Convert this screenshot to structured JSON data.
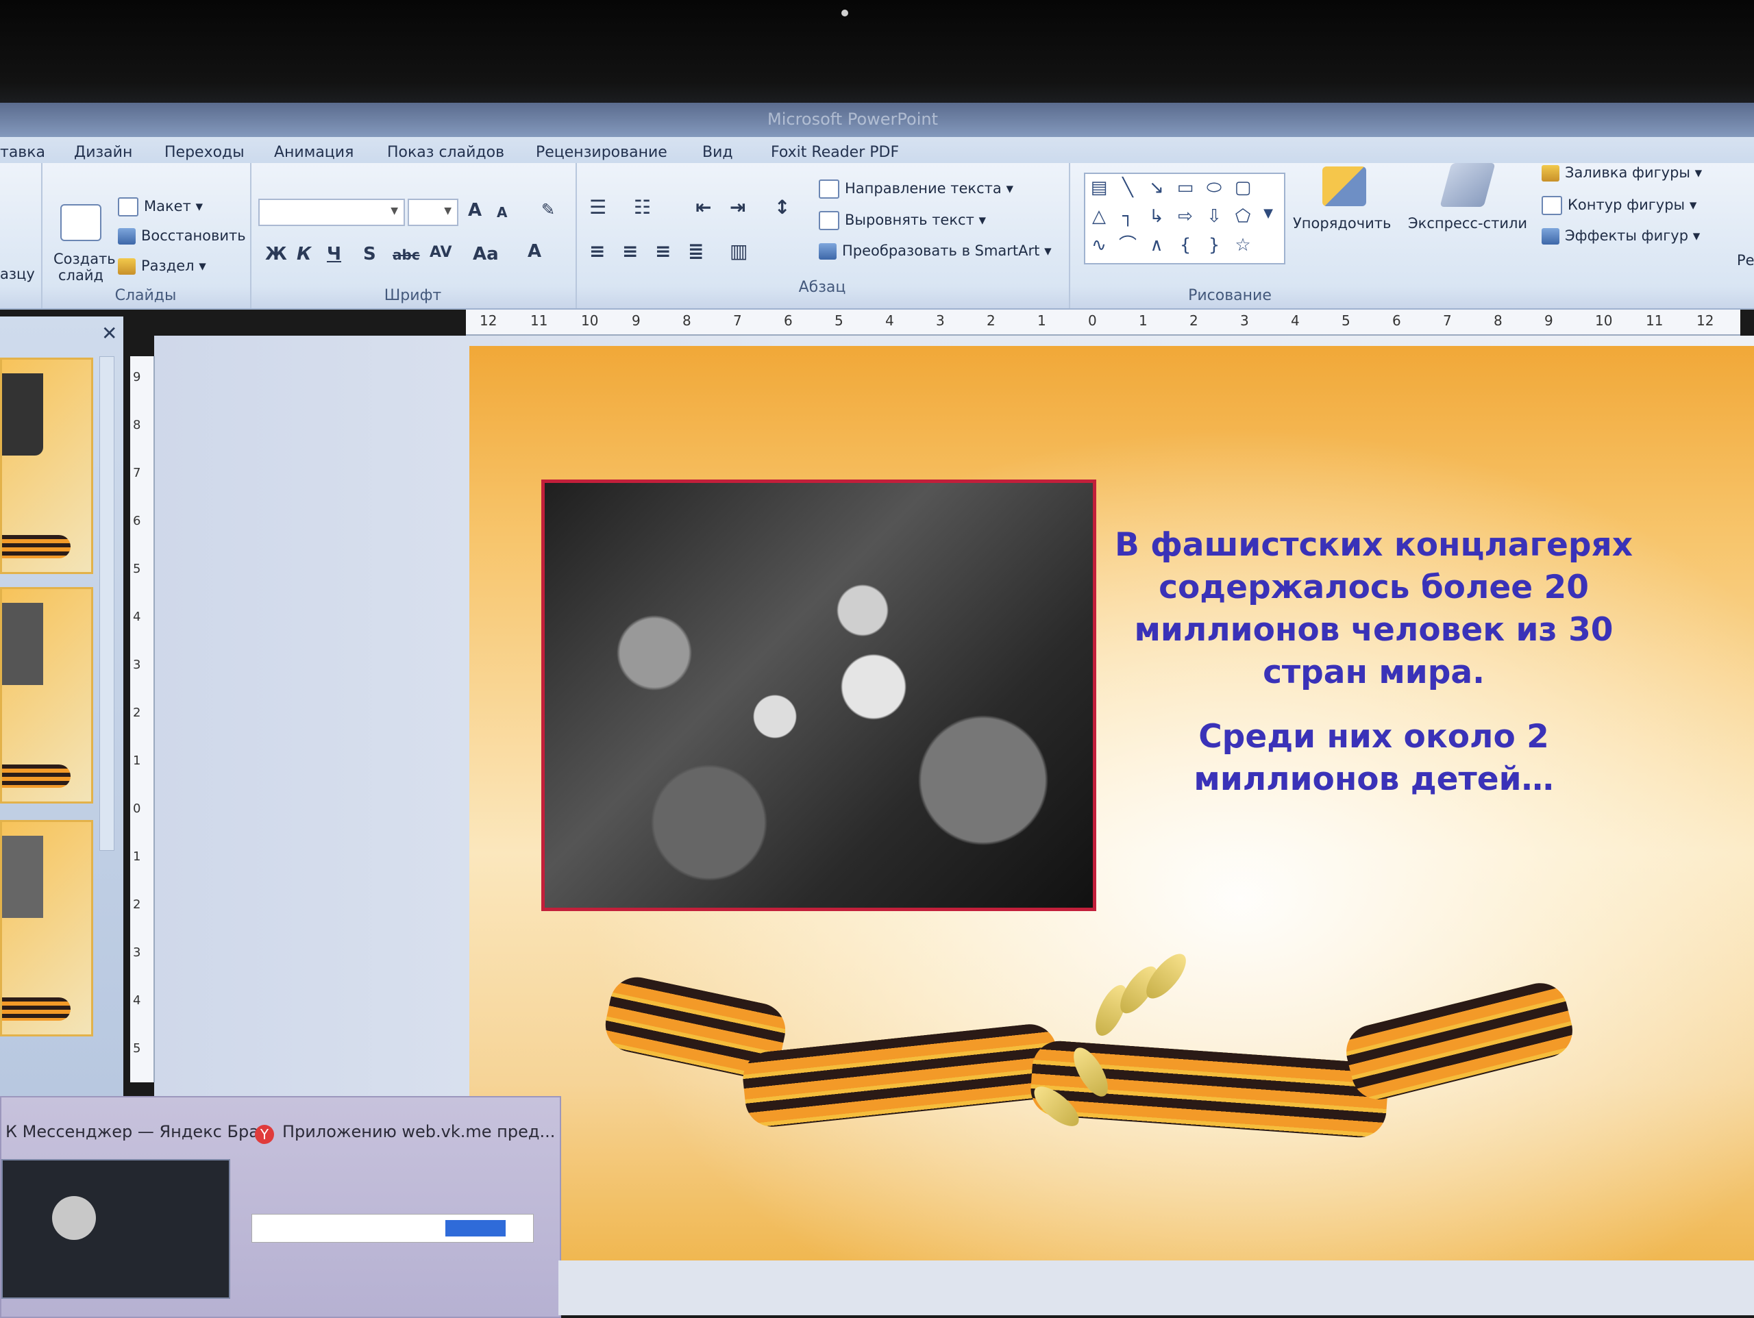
{
  "window": {
    "title": "Microsoft PowerPoint"
  },
  "tabs": [
    "тавка",
    "Дизайн",
    "Переходы",
    "Анимация",
    "Показ слайдов",
    "Рецензирование",
    "Вид",
    "Foxit Reader PDF"
  ],
  "ribbon": {
    "slides": {
      "new_slide": "Создать слайд",
      "layout": "Макет",
      "reset": "Восстановить",
      "section": "Раздел",
      "label": "Слайды",
      "left_cut": "азцу"
    },
    "font": {
      "label": "Шрифт",
      "bold": "Ж",
      "italic": "К",
      "underline": "Ч",
      "shadow": "S",
      "strike": "abc",
      "spacing": "AV",
      "case": "Aa",
      "color": "A",
      "grow": "A",
      "shrink": "A"
    },
    "paragraph": {
      "label": "Абзац",
      "text_direction": "Направление текста",
      "align_text": "Выровнять текст",
      "smartart": "Преобразовать в SmartArt"
    },
    "drawing": {
      "label": "Рисование",
      "arrange": "Упорядочить",
      "quick_styles": "Экспресс-стили",
      "fill": "Заливка фигуры",
      "outline": "Контур фигуры",
      "effects": "Эффекты фигур"
    },
    "right_cut": "Ре"
  },
  "ruler": {
    "marks": [
      "12",
      "11",
      "10",
      "9",
      "8",
      "7",
      "6",
      "5",
      "4",
      "3",
      "2",
      "1",
      "0",
      "1",
      "2",
      "3",
      "4",
      "5",
      "6",
      "7",
      "8",
      "9",
      "10",
      "11",
      "12"
    ]
  },
  "vruler": {
    "marks": [
      "9",
      "8",
      "7",
      "6",
      "5",
      "4",
      "3",
      "2",
      "1",
      "0",
      "1",
      "2",
      "3",
      "4",
      "5"
    ]
  },
  "slide": {
    "text_para1": "В фашистских концлагерях содержалось более 20 миллионов человек из 30 стран мира.",
    "text_para2": "Среди них около 2  миллионов детей…",
    "text_color": "#3a32b8",
    "photo_border_color": "#c21f3a"
  },
  "taskbar_popup": {
    "item1": "К Мессенджер — Яндекс Бра...",
    "item2": "Приложению web.vk.me пред..."
  }
}
